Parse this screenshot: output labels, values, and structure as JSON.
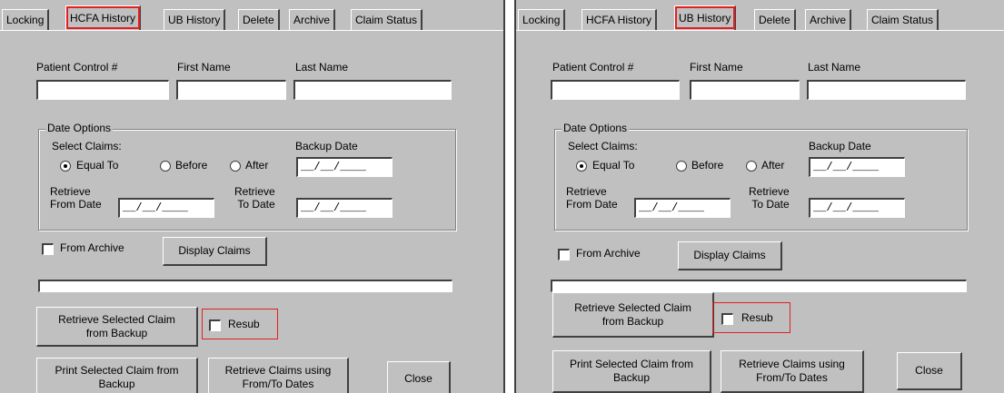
{
  "panels": [
    {
      "tabs": [
        {
          "label": "Locking",
          "active": false,
          "highlighted": false
        },
        {
          "label": "HCFA History",
          "active": true,
          "highlighted": true
        },
        {
          "label": "UB History",
          "active": false,
          "highlighted": false
        },
        {
          "label": "Delete",
          "active": false,
          "highlighted": false
        },
        {
          "label": "Archive",
          "active": false,
          "highlighted": false
        },
        {
          "label": "Claim Status",
          "active": false,
          "highlighted": false
        }
      ],
      "fields": {
        "patient_control_label": "Patient Control #",
        "first_name_label": "First Name",
        "last_name_label": "Last Name",
        "patient_control_value": "",
        "first_name_value": "",
        "last_name_value": ""
      },
      "date_options": {
        "title": "Date Options",
        "select_claims_label": "Select Claims:",
        "equal_to": "Equal To",
        "before": "Before",
        "after": "After",
        "selected": "Equal To",
        "backup_date_label": "Backup Date",
        "backup_date_value": "__/__/____",
        "retrieve_from_label": "Retrieve\nFrom Date",
        "retrieve_from_value": "__/__/____",
        "retrieve_to_label": "Retrieve\nTo Date",
        "retrieve_to_value": "__/__/____"
      },
      "from_archive_label": "From Archive",
      "from_archive_checked": false,
      "display_claims_label": "Display Claims",
      "retrieve_selected_label": "Retrieve Selected Claim\nfrom Backup",
      "resub_label": "Resub",
      "resub_checked": false,
      "print_selected_label": "Print Selected Claim from\nBackup",
      "retrieve_using_label": "Retrieve Claims using\nFrom/To Dates",
      "close_label": "Close"
    },
    {
      "tabs": [
        {
          "label": "Locking",
          "active": false,
          "highlighted": false
        },
        {
          "label": "HCFA History",
          "active": false,
          "highlighted": false
        },
        {
          "label": "UB History",
          "active": true,
          "highlighted": true
        },
        {
          "label": "Delete",
          "active": false,
          "highlighted": false
        },
        {
          "label": "Archive",
          "active": false,
          "highlighted": false
        },
        {
          "label": "Claim Status",
          "active": false,
          "highlighted": false
        }
      ],
      "fields": {
        "patient_control_label": "Patient Control #",
        "first_name_label": "First Name",
        "last_name_label": "Last Name",
        "patient_control_value": "",
        "first_name_value": "",
        "last_name_value": ""
      },
      "date_options": {
        "title": "Date Options",
        "select_claims_label": "Select Claims:",
        "equal_to": "Equal To",
        "before": "Before",
        "after": "After",
        "selected": "Equal To",
        "backup_date_label": "Backup Date",
        "backup_date_value": "__/__/____",
        "retrieve_from_label": "Retrieve\nFrom Date",
        "retrieve_from_value": "__/__/____",
        "retrieve_to_label": "Retrieve\nTo Date",
        "retrieve_to_value": "__/__/____"
      },
      "from_archive_label": "From Archive",
      "from_archive_checked": false,
      "display_claims_label": "Display Claims",
      "retrieve_selected_label": "Retrieve Selected Claim\nfrom Backup",
      "resub_label": "Resub",
      "resub_checked": false,
      "print_selected_label": "Print Selected Claim from\nBackup",
      "retrieve_using_label": "Retrieve Claims using\nFrom/To Dates",
      "close_label": "Close"
    }
  ],
  "colors": {
    "dialog_bg": "#c0c0c0",
    "highlight": "#e02020"
  }
}
